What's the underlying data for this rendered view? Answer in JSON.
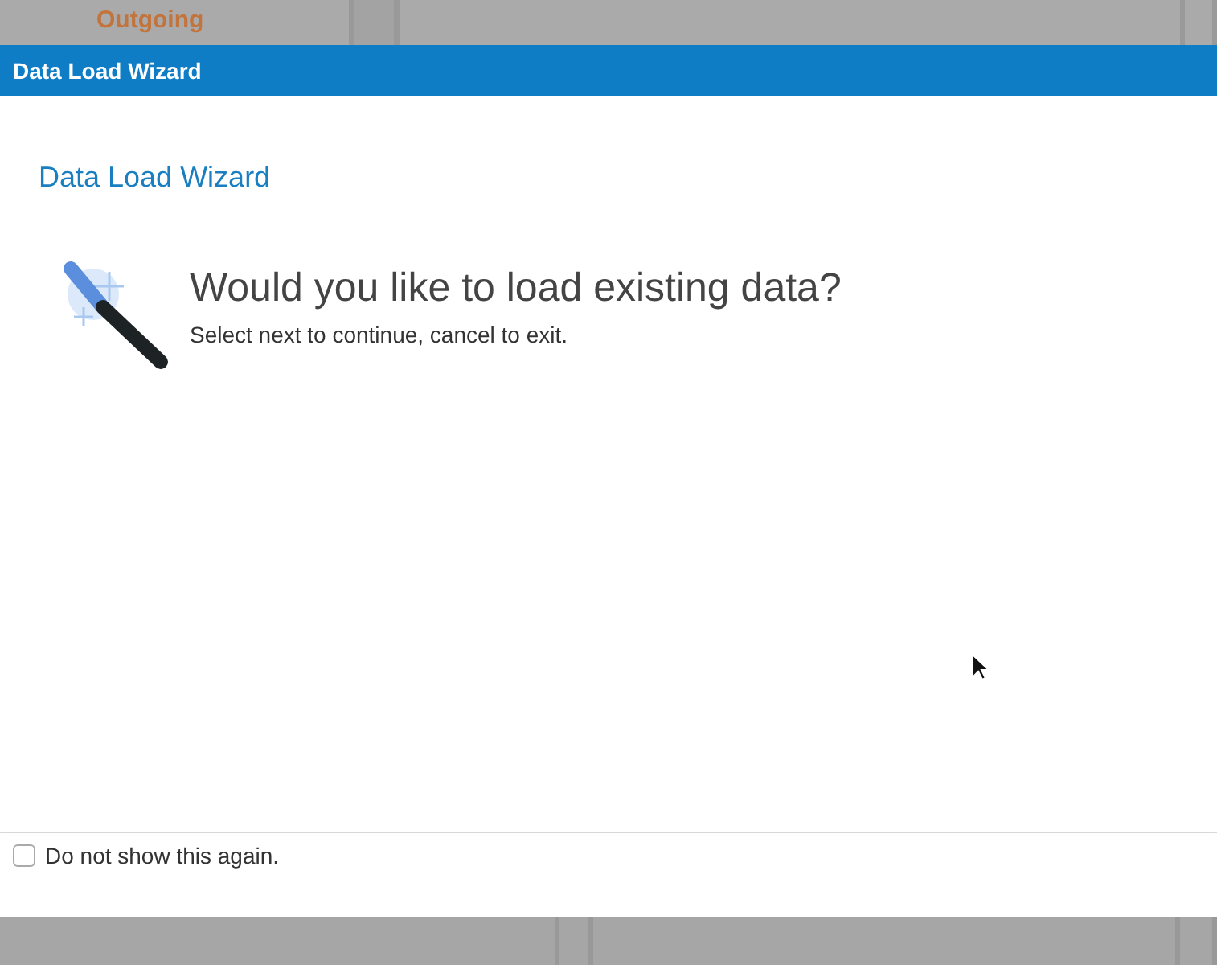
{
  "background": {
    "heading": "Outgoing"
  },
  "dialog": {
    "title": "Data Load Wizard",
    "heading": "Data Load Wizard",
    "question": "Would you like to load existing data?",
    "hint": "Select next to continue, cancel to exit.",
    "footer": {
      "checkbox_label": "Do not show this again.",
      "checked": false
    }
  }
}
